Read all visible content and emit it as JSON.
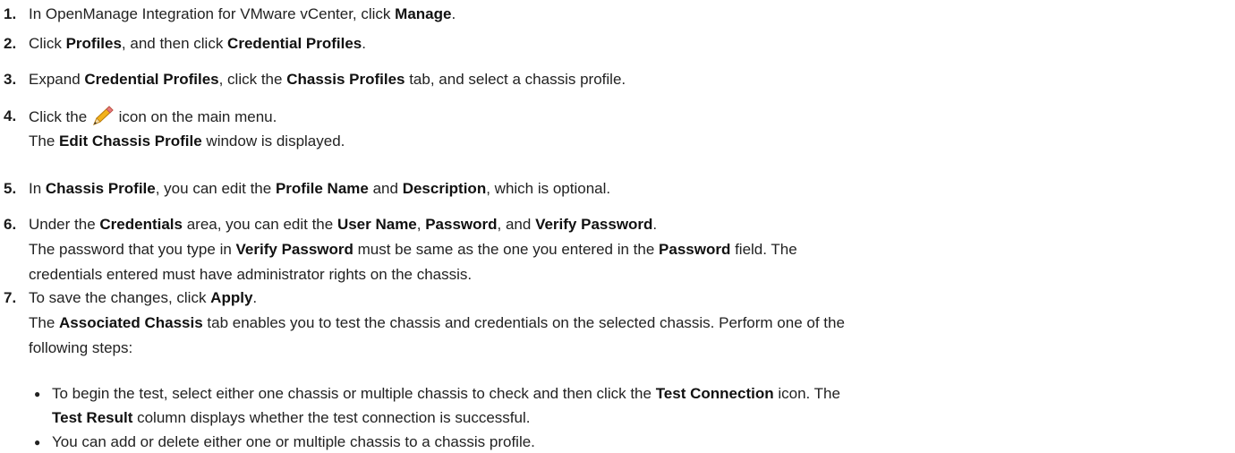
{
  "steps": [
    {
      "number": "1.",
      "lines": [
        [
          {
            "t": "In OpenManage Integration for VMware vCenter, click "
          },
          {
            "t": "Manage",
            "b": true
          },
          {
            "t": "."
          }
        ]
      ]
    },
    {
      "number": "2.",
      "lines": [
        [
          {
            "t": "Click "
          },
          {
            "t": "Profiles",
            "b": true
          },
          {
            "t": ", and then click "
          },
          {
            "t": "Credential Profiles",
            "b": true
          },
          {
            "t": "."
          }
        ]
      ]
    },
    {
      "number": "3.",
      "lines": [
        [
          {
            "t": "Expand "
          },
          {
            "t": "Credential Profiles",
            "b": true
          },
          {
            "t": ", click the "
          },
          {
            "t": "Chassis Profiles",
            "b": true
          },
          {
            "t": " tab, and select a chassis profile."
          }
        ]
      ]
    },
    {
      "number": "4.",
      "lines": [
        [
          {
            "t": "Click the "
          },
          {
            "icon": "pencil-icon"
          },
          {
            "t": " icon on the main menu."
          }
        ],
        [
          {
            "t": "The "
          },
          {
            "t": "Edit Chassis Profile",
            "b": true
          },
          {
            "t": " window is displayed."
          }
        ]
      ]
    },
    {
      "number": "5.",
      "lines": [
        [
          {
            "t": "In "
          },
          {
            "t": "Chassis Profile",
            "b": true
          },
          {
            "t": ", you can edit the "
          },
          {
            "t": "Profile Name",
            "b": true
          },
          {
            "t": " and "
          },
          {
            "t": "Description",
            "b": true
          },
          {
            "t": ", which is optional."
          }
        ]
      ]
    },
    {
      "number": "6.",
      "lines": [
        [
          {
            "t": "Under the "
          },
          {
            "t": "Credentials",
            "b": true
          },
          {
            "t": " area, you can edit the "
          },
          {
            "t": "User Name",
            "b": true
          },
          {
            "t": ", "
          },
          {
            "t": "Password",
            "b": true
          },
          {
            "t": ", and "
          },
          {
            "t": "Verify Password",
            "b": true
          },
          {
            "t": "."
          }
        ],
        [
          {
            "t": "The password that you type in "
          },
          {
            "t": "Verify Password",
            "b": true
          },
          {
            "t": " must be same as the one you entered in the "
          },
          {
            "t": "Password",
            "b": true
          },
          {
            "t": " field. The"
          }
        ],
        [
          {
            "t": "credentials entered must have administrator rights on the chassis."
          }
        ]
      ]
    },
    {
      "number": "7.",
      "lines": [
        [
          {
            "t": "To save the changes, click "
          },
          {
            "t": "Apply",
            "b": true
          },
          {
            "t": "."
          }
        ],
        [
          {
            "t": "The "
          },
          {
            "t": "Associated Chassis",
            "b": true
          },
          {
            "t": " tab enables you to test the chassis and credentials on the selected chassis. Perform one of the"
          }
        ],
        [
          {
            "t": "following steps:"
          }
        ]
      ],
      "bullets": [
        {
          "symbol": "●",
          "lines": [
            [
              {
                "t": "To begin the test, select either one chassis or multiple chassis to check and then click the "
              },
              {
                "t": "Test Connection",
                "b": true
              },
              {
                "t": " icon. The"
              }
            ],
            [
              {
                "t": "Test Result",
                "b": true
              },
              {
                "t": " column displays whether the test connection is successful."
              }
            ]
          ]
        },
        {
          "symbol": "●",
          "lines": [
            [
              {
                "t": "You can add or delete either one or multiple chassis to a chassis profile."
              }
            ]
          ]
        }
      ]
    }
  ]
}
